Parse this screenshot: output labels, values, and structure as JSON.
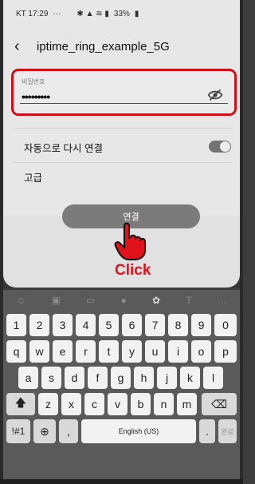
{
  "status_bar": {
    "time": "KT 17:29",
    "dots": "···",
    "right": "33%"
  },
  "header": {
    "title": "iptime_ring_example_5G"
  },
  "password": {
    "label": "비밀번호",
    "value": "•••••••••"
  },
  "settings": {
    "auto_reconnect": "자동으로 다시 연결",
    "auto_reconnect_on": true,
    "advanced": "고급"
  },
  "connect_button": "연결",
  "click_label": "Click",
  "keyboard": {
    "row1": [
      "1",
      "2",
      "3",
      "4",
      "5",
      "6",
      "7",
      "8",
      "9",
      "0"
    ],
    "row2": [
      "q",
      "w",
      "e",
      "r",
      "t",
      "y",
      "u",
      "i",
      "o",
      "p"
    ],
    "row3": [
      "a",
      "s",
      "d",
      "f",
      "g",
      "h",
      "j",
      "k",
      "l"
    ],
    "row4": [
      "z",
      "x",
      "c",
      "v",
      "b",
      "n",
      "m"
    ],
    "symbols": "!#1",
    "comma": ",",
    "space": "English (US)",
    "period": ".",
    "done": "완료"
  },
  "colors": {
    "highlight": "#e0121b",
    "button": "#7b7b7b",
    "keyboard_bg": "#5a5a5a"
  }
}
